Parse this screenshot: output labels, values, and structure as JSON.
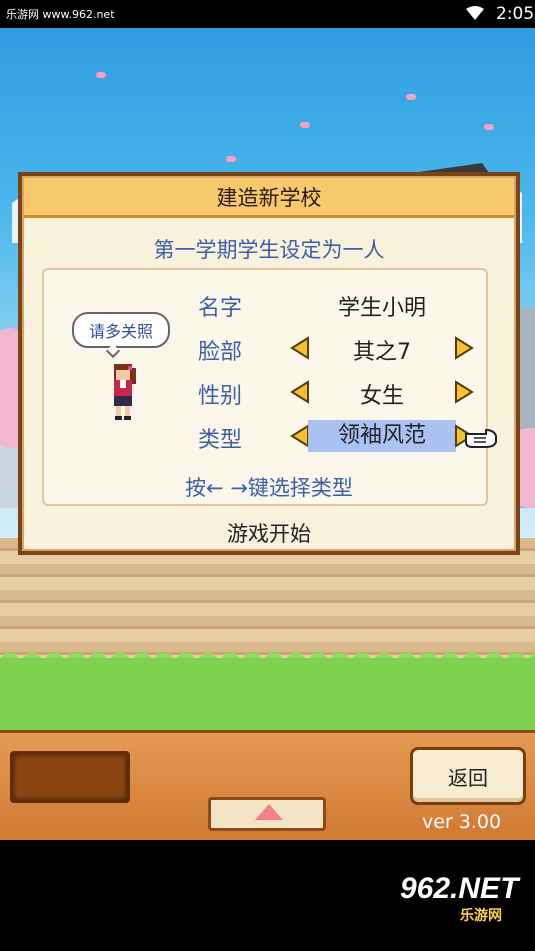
{
  "status_bar": {
    "watermark": "乐游网 www.962.net",
    "time": "2:05"
  },
  "dialog": {
    "title": "建造新学校",
    "subtitle": "第一学期学生设定为一人",
    "speech": "请多关照",
    "fields": [
      {
        "label": "名字",
        "value": "学生小明"
      },
      {
        "label": "脸部",
        "value": "其之7"
      },
      {
        "label": "性别",
        "value": "女生"
      },
      {
        "label": "类型",
        "value": "领袖风范"
      }
    ],
    "hint": "按← →键选择类型",
    "start_label": "游戏开始"
  },
  "bottom_panel": {
    "back_label": "返回",
    "version": "ver 3.00"
  },
  "watermark_logo": {
    "text": "962.NET",
    "sub": "乐游网"
  },
  "colors": {
    "label_blue": "#3d5fa8",
    "title_bar": "#f6ca6c",
    "selected": "#a9c2f2",
    "panel_orange": "#e49a54"
  }
}
